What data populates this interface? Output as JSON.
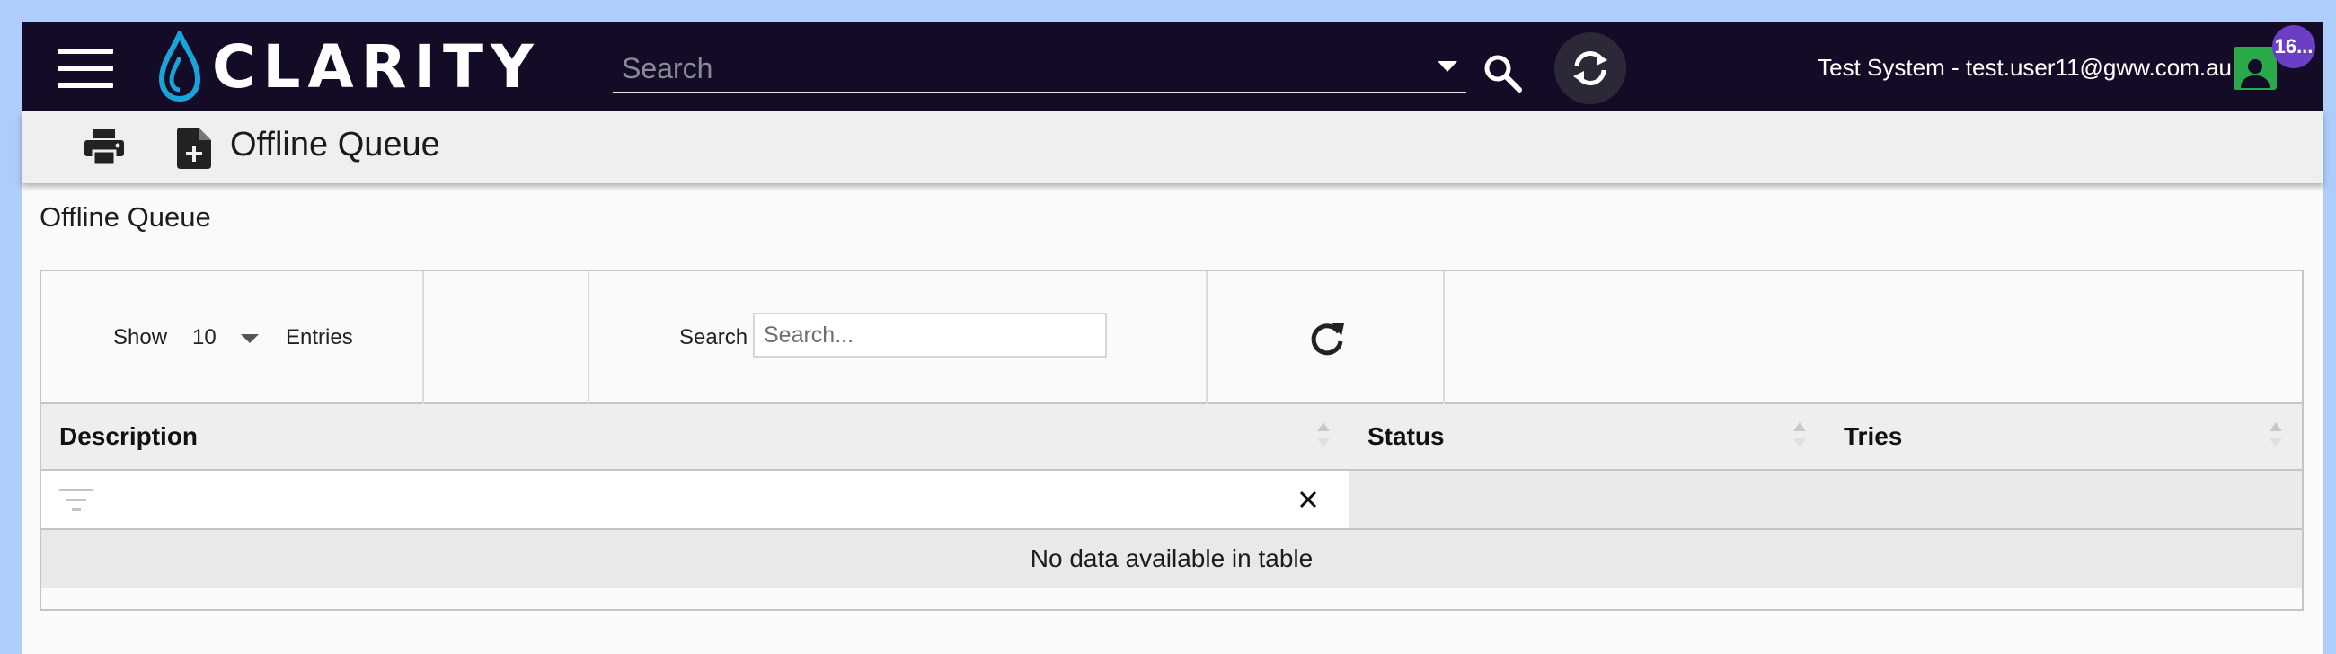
{
  "colors": {
    "topbar": "#140b27",
    "accent": "#1aa3d9",
    "avatar": "#2aa84a",
    "badge": "#6a3fc6",
    "background": "#afcdfb"
  },
  "header": {
    "logo_text": "CLARITY",
    "search_placeholder": "Search",
    "user_label": "Test System - test.user11@gww.com.au",
    "notification_count": "16..."
  },
  "toolbar": {
    "title": "Offline Queue",
    "icons": [
      "print-icon",
      "new-document-icon"
    ]
  },
  "page": {
    "heading": "Offline Queue"
  },
  "table": {
    "show_label": "Show",
    "page_size": "10",
    "entries_label": "Entries",
    "search_label": "Search",
    "search_placeholder": "Search...",
    "columns": [
      "Description",
      "Status",
      "Tries"
    ],
    "empty_message": "No data available in table"
  }
}
